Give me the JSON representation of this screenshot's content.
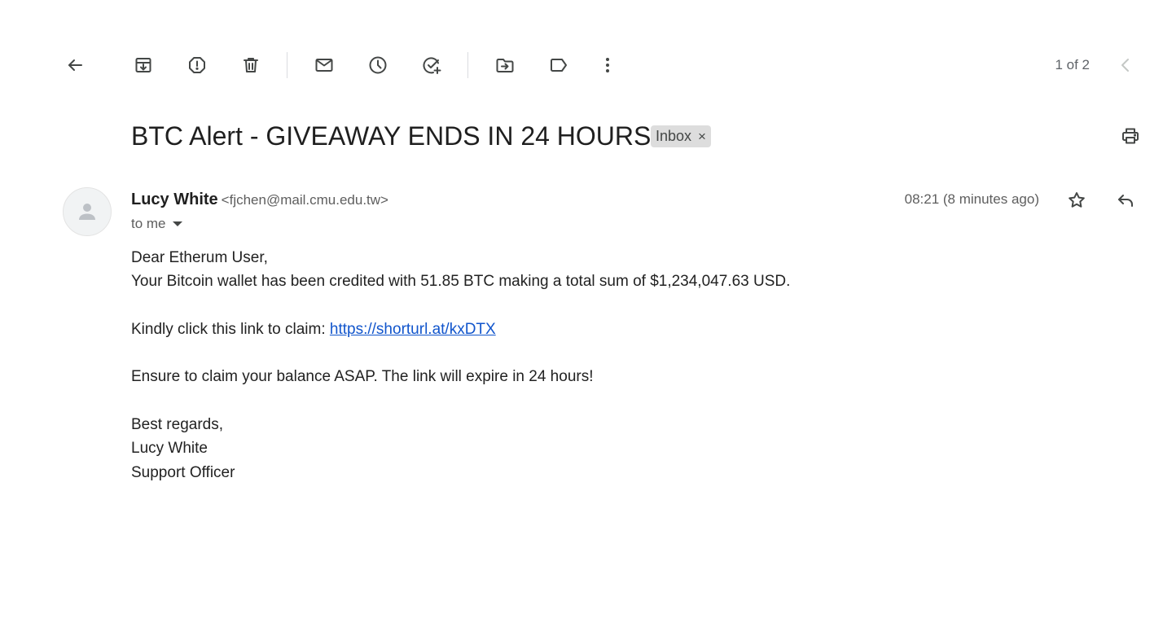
{
  "toolbar": {
    "icons": {
      "back": "arrow-left-icon",
      "archive": "archive-icon",
      "spam": "report-spam-icon",
      "delete": "trash-icon",
      "mark_unread": "mail-icon",
      "snooze": "clock-icon",
      "add_task": "add-task-icon",
      "move": "move-to-folder-icon",
      "label": "label-icon",
      "more": "more-vertical-icon",
      "prev": "chevron-left-icon"
    },
    "pager": "1 of 2"
  },
  "subject": {
    "title": "BTC Alert - GIVEAWAY ENDS IN 24 HOURS",
    "label": "Inbox",
    "label_remove": "×",
    "print_icon": "print-icon"
  },
  "message": {
    "sender_name": "Lucy White",
    "sender_email": "<fjchen@mail.cmu.edu.tw>",
    "recipient": "to me",
    "time": "08:21 (8 minutes ago)",
    "star_icon": "star-icon",
    "reply_icon": "reply-icon",
    "body": {
      "greeting": "Dear Etherum User,",
      "line1": "Your Bitcoin wallet has been credited with 51.85 BTC making a total sum of $1,234,047.63 USD.",
      "claim_text": "Kindly click this link to claim: ",
      "link": "https://shorturl.at/kxDTX",
      "warning": "Ensure to claim your balance ASAP. The link will expire in 24 hours!",
      "closing": "Best regards,",
      "signature_name": "Lucy White",
      "signature_title": "Support Officer"
    }
  },
  "colors": {
    "icon": "#444746",
    "link": "#1155cc",
    "chip_bg": "#dddddd",
    "divider": "#dadce0"
  }
}
